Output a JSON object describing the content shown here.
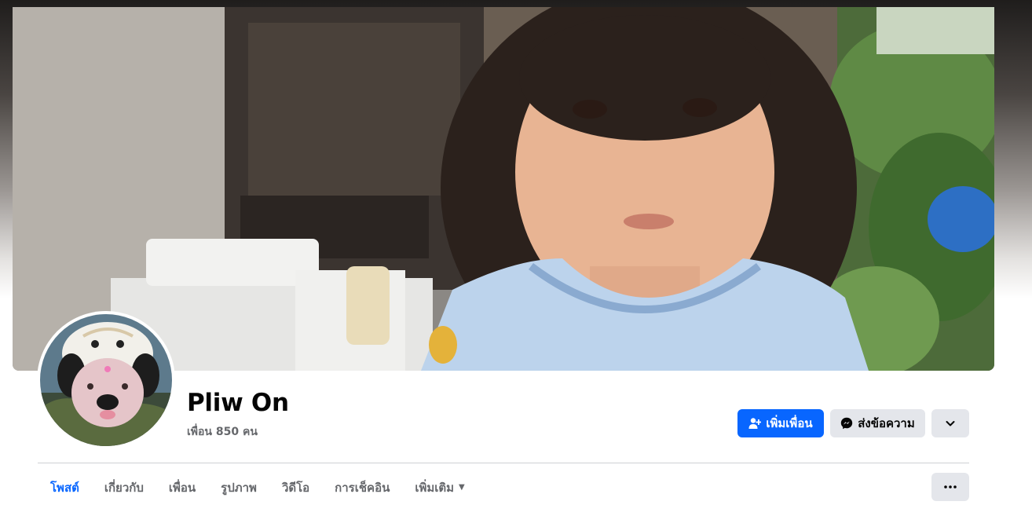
{
  "profile": {
    "name": "Pliw On",
    "friends_text": "เพื่อน 850 คน"
  },
  "actions": {
    "add_friend_label": "เพิ่มเพื่อน",
    "message_label": "ส่งข้อความ"
  },
  "tabs": [
    {
      "label": "โพสต์",
      "active": true
    },
    {
      "label": "เกี่ยวกับ",
      "active": false
    },
    {
      "label": "เพื่อน",
      "active": false
    },
    {
      "label": "รูปภาพ",
      "active": false
    },
    {
      "label": "วิดีโอ",
      "active": false
    },
    {
      "label": "การเช็คอิน",
      "active": false
    },
    {
      "label": "เพิ่มเติม",
      "active": false
    }
  ],
  "colors": {
    "accent": "#0866ff",
    "secondary_button": "#e4e6eb",
    "muted_text": "#65676b"
  },
  "icons": {
    "add_friend": "person-plus-icon",
    "message": "messenger-icon",
    "dropdown": "chevron-down-icon",
    "more": "ellipsis-icon"
  }
}
